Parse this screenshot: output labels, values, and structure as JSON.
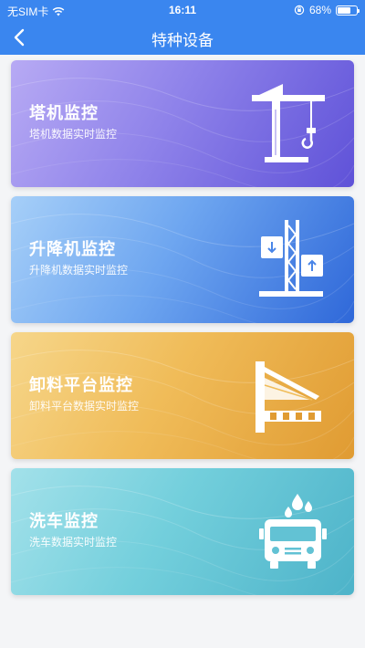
{
  "status_bar": {
    "carrier": "无SIM卡",
    "time": "16:11",
    "battery": "68%",
    "battery_level": 0.68
  },
  "nav": {
    "title": "特种设备",
    "back_icon": "chevron-left-icon"
  },
  "cards": [
    {
      "title": "塔机监控",
      "subtitle": "塔机数据实时监控",
      "icon": "tower-crane-icon"
    },
    {
      "title": "升降机监控",
      "subtitle": "升降机数据实时监控",
      "icon": "elevator-icon"
    },
    {
      "title": "卸料平台监控",
      "subtitle": "卸料平台数据实时监控",
      "icon": "unloading-platform-icon"
    },
    {
      "title": "洗车监控",
      "subtitle": "洗车数据实时监控",
      "icon": "car-wash-icon"
    }
  ]
}
